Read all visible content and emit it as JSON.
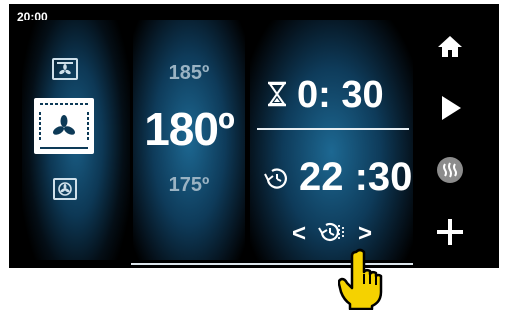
{
  "status_bar": {
    "clock": "20:00"
  },
  "cooking_modes": {
    "items": [
      {
        "icon": "top-heat-icon",
        "selected": false
      },
      {
        "icon": "fan-heat-icon",
        "selected": true
      },
      {
        "icon": "fan-only-icon",
        "selected": false
      }
    ]
  },
  "temperature": {
    "above": "185º",
    "current": "180º",
    "below": "175º"
  },
  "timer": {
    "duration": "0: 30",
    "end_time": "22 :30"
  },
  "time_nav": {
    "prev": "<",
    "next": ">"
  },
  "sidebar": {
    "home": "home-icon",
    "start": "play-icon",
    "steam": "steam-icon",
    "add": "plus-icon"
  },
  "colors": {
    "accent_blue": "#1d6892",
    "pointer_yellow": "#f5d200"
  }
}
